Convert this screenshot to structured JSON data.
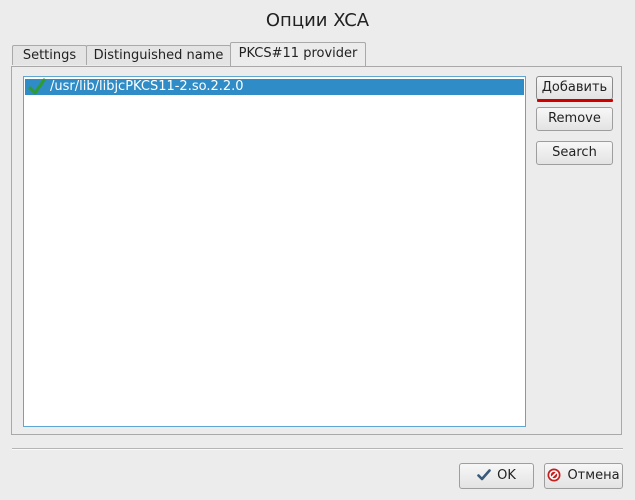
{
  "dialog": {
    "title": "Опции XCA"
  },
  "tabs": [
    {
      "label": "Settings"
    },
    {
      "label": "Distinguished name"
    },
    {
      "label": "PKCS#11 provider"
    }
  ],
  "providers": [
    {
      "path": "/usr/lib/libjcPKCS11-2.so.2.2.0",
      "enabled": true
    }
  ],
  "side_buttons": {
    "add": "Добавить",
    "remove": "Remove",
    "search": "Search"
  },
  "footer": {
    "ok": "OK",
    "cancel": "Отмена"
  },
  "colors": {
    "selection": "#308cc6",
    "focus_underline": "#d00000",
    "check_green": "#2e9c2e",
    "cancel_red": "#c4201f"
  },
  "icons": {
    "provider_status": "green-check-icon",
    "ok": "check-icon",
    "cancel": "cancel-icon"
  }
}
